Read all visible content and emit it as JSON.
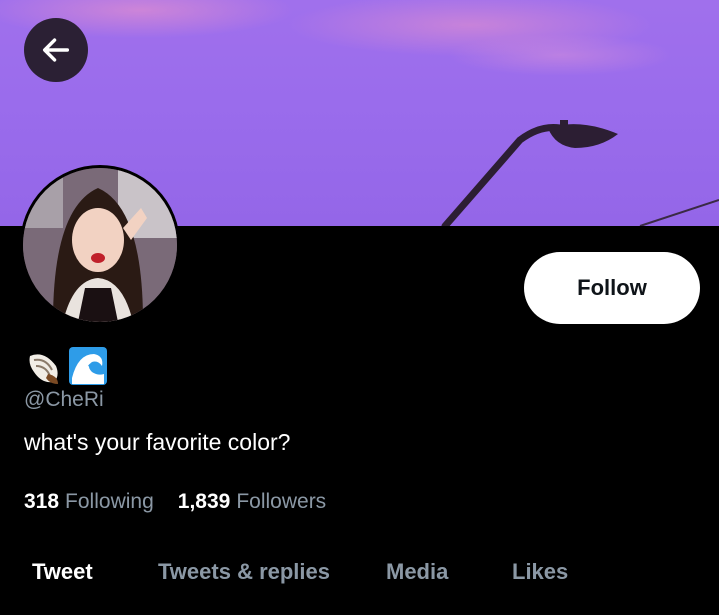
{
  "banner": {
    "description_colors": {
      "sky": "#9a6cec",
      "clouds": "#f096c8",
      "lamp": "#2c1e33"
    }
  },
  "header": {
    "back_icon": "arrow-left-icon"
  },
  "profile": {
    "emojis": [
      "spiral-shell-icon",
      "water-wave-icon"
    ],
    "handle": "@CheRi",
    "bio": "what's your favorite color?",
    "follow_label": "Follow"
  },
  "stats": {
    "following_count": "318",
    "following_label": "Following",
    "followers_count": "1,839",
    "followers_label": "Followers"
  },
  "tabs": [
    {
      "label": "Tweet",
      "active": true
    },
    {
      "label": "Tweets & replies",
      "active": false
    },
    {
      "label": "Media",
      "active": false
    },
    {
      "label": "Likes",
      "active": false
    }
  ],
  "colors": {
    "background": "#000000",
    "muted_text": "#8b98a5",
    "button_bg": "#ffffff"
  }
}
